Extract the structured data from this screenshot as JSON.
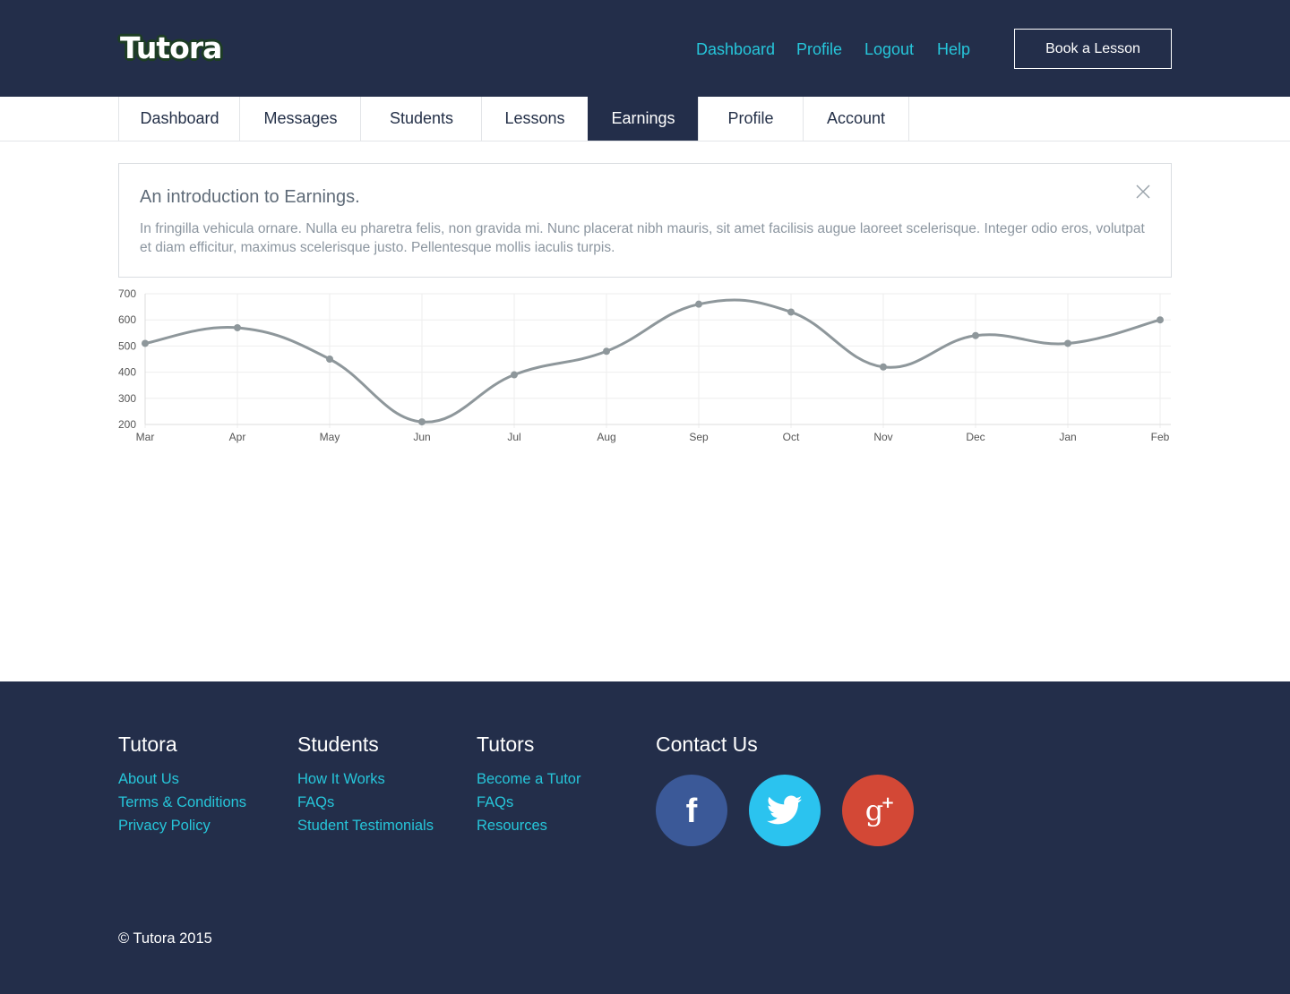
{
  "brand": {
    "logo": "Tutora"
  },
  "header": {
    "nav": [
      "Dashboard",
      "Profile",
      "Logout",
      "Help"
    ],
    "cta": "Book a Lesson"
  },
  "tabs": [
    "Dashboard",
    "Messages",
    "Students",
    "Lessons",
    "Earnings",
    "Profile",
    "Account"
  ],
  "active_tab": "Earnings",
  "intro": {
    "title": "An introduction to Earnings.",
    "body": "In fringilla vehicula ornare. Nulla eu pharetra felis, non gravida mi. Nunc placerat nibh mauris, sit amet facilisis augue laoreet scelerisque. Integer odio eros, volutpat et diam efficitur, maximus scelerisque justo. Pellentesque mollis iaculis turpis.",
    "close_icon": "close-icon"
  },
  "chart_data": {
    "type": "line",
    "categories": [
      "Mar",
      "Apr",
      "May",
      "Jun",
      "Jul",
      "Aug",
      "Sep",
      "Oct",
      "Nov",
      "Dec",
      "Jan",
      "Feb"
    ],
    "values": [
      510,
      570,
      450,
      210,
      390,
      480,
      660,
      630,
      420,
      540,
      510,
      600
    ],
    "ylim": [
      200,
      700
    ],
    "yticks": [
      "700",
      "600",
      "500",
      "400",
      "300",
      "200"
    ],
    "grid": true,
    "line_color": "#8e979b"
  },
  "footer": {
    "columns": [
      {
        "title": "Tutora",
        "links": [
          "About Us",
          "Terms & Conditions",
          "Privacy Policy"
        ]
      },
      {
        "title": "Students",
        "links": [
          "How It Works",
          "FAQs",
          "Student Testimonials"
        ]
      },
      {
        "title": "Tutors",
        "links": [
          "Become a Tutor",
          "FAQs",
          "Resources"
        ]
      }
    ],
    "contact_title": "Contact Us",
    "social": [
      {
        "icon": "facebook-icon",
        "color": "#3b5998"
      },
      {
        "icon": "twitter-icon",
        "color": "#2bc3ef"
      },
      {
        "icon": "google-plus-icon",
        "color": "#d34836"
      }
    ],
    "copyright": "© Tutora 2015"
  },
  "colors": {
    "navy": "#232e4a",
    "accent": "#26c6da"
  }
}
